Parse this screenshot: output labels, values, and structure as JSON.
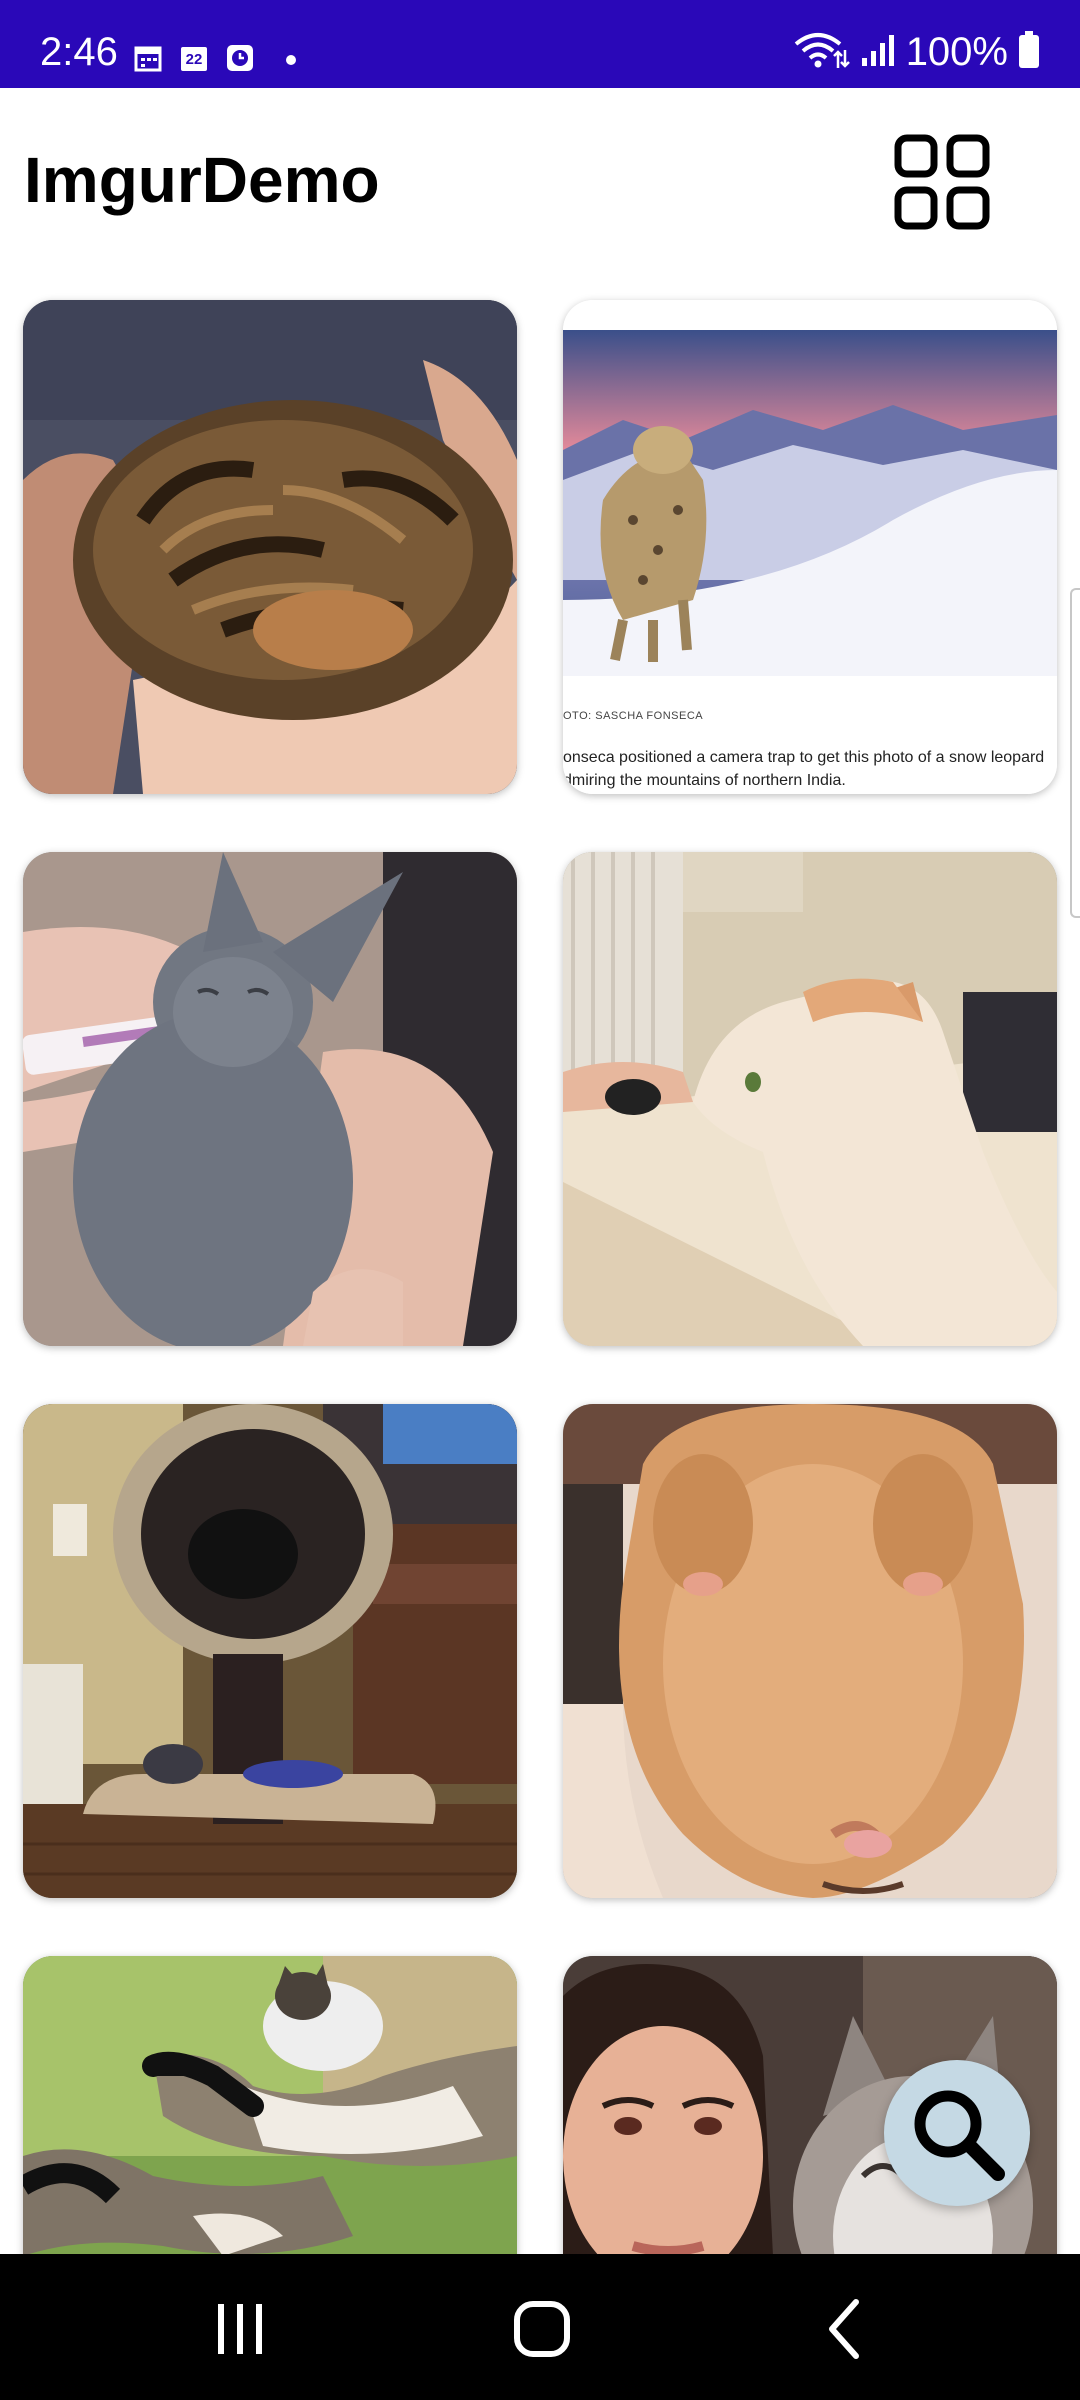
{
  "status_bar": {
    "time": "2:46",
    "calendar_day": "22",
    "battery": "100%",
    "background_color": "#2a08b8"
  },
  "app_bar": {
    "title": "ImgurDemo",
    "layout_toggle_icon": "grid-view-icon"
  },
  "gallery": {
    "items": [
      {
        "subject": "kitten-curled-in-hand"
      },
      {
        "subject": "snow-leopard-photo-article",
        "credit": "OTO: SASCHA FONSECA",
        "caption": "onseca positioned a camera trap to get this photo of a snow leopard dmiring the mountains of northern India."
      },
      {
        "subject": "gray-kitten-eating-treat"
      },
      {
        "subject": "cat-resting-on-desk"
      },
      {
        "subject": "cat-tree-tower"
      },
      {
        "subject": "orange-cat-upside-down"
      },
      {
        "subject": "cat-riding-goose"
      },
      {
        "subject": "woman-with-cat"
      }
    ]
  },
  "fab": {
    "icon": "search-icon",
    "color": "#c5d9e4"
  },
  "nav_bar": {
    "recents_icon": "recents-icon",
    "home_icon": "home-icon",
    "back_icon": "back-icon"
  }
}
